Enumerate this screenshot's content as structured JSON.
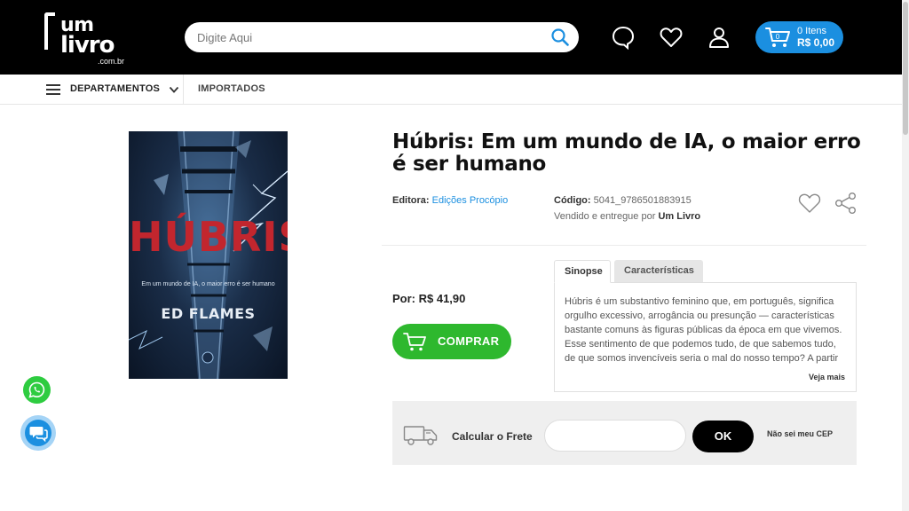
{
  "header": {
    "logo": {
      "line1": "um",
      "line2": "livro",
      "domain": ".com.br"
    },
    "search": {
      "placeholder": "Digite Aqui",
      "value": ""
    },
    "icons": [
      "chat-bubble-icon",
      "heart-icon",
      "user-icon",
      "cart-icon"
    ],
    "cart": {
      "count_label": "0 Itens",
      "total": "R$ 0,00"
    },
    "colors": {
      "bg": "#000000",
      "accent": "#1b8fe0"
    }
  },
  "nav": {
    "departments_label": "DEPARTAMENTOS",
    "imported_label": "IMPORTADOS"
  },
  "product": {
    "cover": {
      "title": "HÚBRIS",
      "subtitle": "Em um mundo de IA, o maior erro é ser humano",
      "author": "ED FLAMES"
    },
    "title": "Húbris: Em um mundo de IA, o maior erro é ser humano",
    "publisher_label": "Editora:",
    "publisher": "Edições Procópio",
    "code_label": "Código:",
    "code": "5041_9786501883915",
    "sold_by_prefix": "Vendido e entregue por",
    "sold_by": "Um Livro",
    "price": "Por: R$ 41,90",
    "buy_label": "COMPRAR",
    "buy_color": "#2eb82e"
  },
  "tabs": {
    "items": [
      {
        "label": "Sinopse",
        "active": true
      },
      {
        "label": "Características",
        "active": false
      }
    ],
    "synopsis": "Húbris é um substantivo feminino que, em português, significa orgulho excessivo, arrogância ou presunção — características bastante comuns às figuras públicas da época em que vivemos. Esse sentimento de que podemos tudo, de que sabemos tudo, de que somos invencíveis seria o mal do nosso tempo? A partir",
    "see_more": "Veja mais"
  },
  "shipping": {
    "label": "Calcular o Frete",
    "cep_value": "",
    "ok_label": "OK",
    "unknown_cep": "Não sei meu CEP"
  },
  "floating": {
    "whatsapp_color": "#2ecc40",
    "chat_color": "#1b8fe0"
  }
}
